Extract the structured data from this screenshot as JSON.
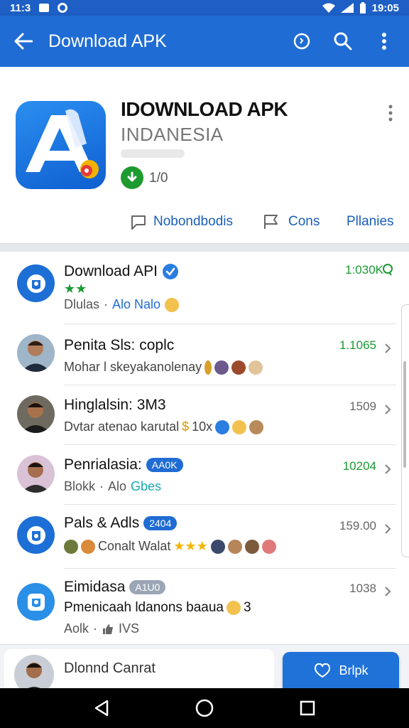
{
  "status_bar": {
    "left_text": "11:3",
    "time": "19:05"
  },
  "app_bar": {
    "title": "Download APK",
    "icons": [
      "arrow-back-icon",
      "history-icon",
      "search-icon",
      "more-vert-icon"
    ],
    "color": "#1f6cd4"
  },
  "header": {
    "app_name": "IDOWNLOAD APK",
    "developer": "INDANESIA",
    "download_count": "1/0",
    "actions": [
      {
        "label": "Nobondbodis",
        "icon": "chat-bubble-icon"
      },
      {
        "label": "Cons",
        "icon": "flag-icon"
      },
      {
        "label": "Pllanies",
        "icon": ""
      }
    ]
  },
  "list": [
    {
      "title": "Download API",
      "verified": true,
      "value": "1:030K",
      "value_color": "green",
      "rating": "★★",
      "meta_left": "Dlulas",
      "meta_right": "Alo Nalo"
    },
    {
      "title": "Penita Sls: coplc",
      "value": "1.1065",
      "value_color": "green",
      "subtitle": "Mohar l skeyakanolenay"
    },
    {
      "title": "Hinglalsin: 3M3",
      "value": "1509",
      "value_color": "gray",
      "subtitle": "Dvtar atenao karutal",
      "subtitle_extra": "10x"
    },
    {
      "title": "Penrialasia:",
      "tag": "AA0K",
      "value": "10204",
      "value_color": "green",
      "meta_left": "Blokk",
      "meta_right": "Alo",
      "meta_highlight": "Gbes"
    },
    {
      "title": "Pals & Adls",
      "tag": "2404",
      "value": "159.00",
      "value_color": "gray",
      "subtitle": "Conalt Walat",
      "stars": "★★★"
    },
    {
      "title": "Eimidasa",
      "tag": "A1U0",
      "value": "1038",
      "value_color": "gray",
      "subtitle": "Pmenicaah ldanons baaua",
      "subtitle_extra": "3",
      "meta_left": "Aolk",
      "meta_right": "IVS"
    }
  ],
  "bottom_sheet": {
    "contact_name": "Dlonnd Canrat",
    "button_label": "Brlpk"
  },
  "nav_bar": {
    "icons": [
      "back-triangle-icon",
      "home-circle-icon",
      "recents-square-icon"
    ]
  }
}
